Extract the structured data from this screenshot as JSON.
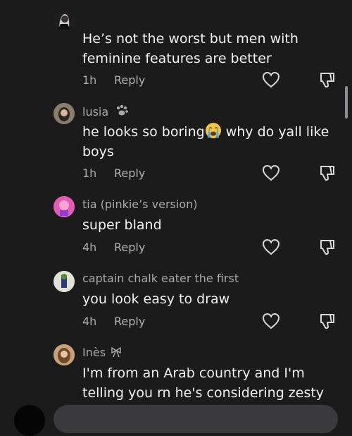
{
  "comments": [
    {
      "username": "",
      "lines": [
        "He’s not the worst but men with",
        "feminine features are better"
      ],
      "time": "1h",
      "reply": "Reply",
      "avatar_color": "#2a2a2a"
    },
    {
      "username": "lusia",
      "username_icon": "paw-icon",
      "lines_a": "he looks so boring",
      "lines_b": " why do yall like",
      "line2": "boys",
      "emoji": "crying-face-icon",
      "time": "1h",
      "reply": "Reply",
      "avatar_color": "#7a6e61"
    },
    {
      "username": "tia (pinkie’s version)",
      "lines": [
        "super bland"
      ],
      "time": "4h",
      "reply": "Reply",
      "avatar_color": "#e048a8"
    },
    {
      "username": "captain chalk eater the first",
      "lines": [
        "you look easy to draw"
      ],
      "time": "4h",
      "reply": "Reply",
      "avatar_color": "#6c7d59"
    },
    {
      "username": "Inès",
      "username_icon": "bow-icon",
      "lines": [
        "I'm from an Arab country and I'm",
        "telling you rn he's considering zesty"
      ],
      "avatar_color": "#b88f66"
    }
  ],
  "colors": {
    "background": "#1b1b1c",
    "text": "#f2f2f2",
    "muted": "#a9a9ad"
  }
}
